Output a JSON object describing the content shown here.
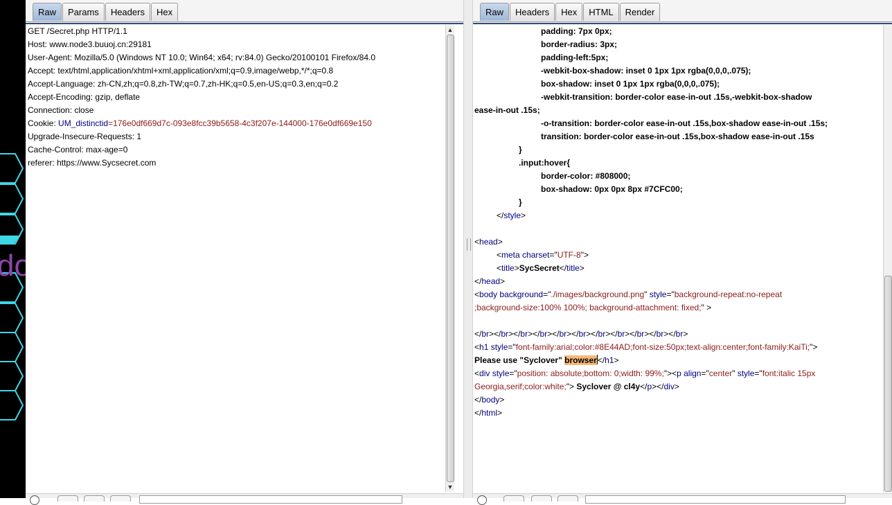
{
  "left_pane": {
    "tabs": [
      "Raw",
      "Params",
      "Headers",
      "Hex"
    ],
    "active_tab": "Raw",
    "request_lines": [
      {
        "text": "GET /Secret.php HTTP/1.1"
      },
      {
        "text": "Host: www.node3.buuoj.cn:29181"
      },
      {
        "text": "User-Agent: Mozilla/5.0 (Windows NT 10.0; Win64; x64; rv:84.0) Gecko/20100101 Firefox/84.0"
      },
      {
        "text": "Accept: text/html,application/xhtml+xml,application/xml;q=0.9,image/webp,*/*;q=0.8"
      },
      {
        "text": "Accept-Language: zh-CN,zh;q=0.8,zh-TW;q=0.7,zh-HK;q=0.5,en-US;q=0.3,en;q=0.2"
      },
      {
        "text": "Accept-Encoding: gzip, deflate"
      },
      {
        "text": "Connection: close"
      },
      {
        "cookie": {
          "label": "Cookie: ",
          "name": "UM_distinctid",
          "eq": "=",
          "value": "176e0df669d7c-093e8fcc39b5658-4c3f207e-144000-176e0df669e150"
        }
      },
      {
        "text": "Upgrade-Insecure-Requests: 1"
      },
      {
        "text": "Cache-Control: max-age=0"
      },
      {
        "text": "referer: https://www.Sycsecret.com"
      }
    ]
  },
  "right_pane": {
    "tabs": [
      "Raw",
      "Headers",
      "Hex",
      "HTML",
      "Render"
    ],
    "active_tab": "Raw",
    "response_lines": [
      {
        "indent": 96,
        "parts": [
          {
            "t": "padding: 7px 0px;",
            "c": "b"
          }
        ]
      },
      {
        "indent": 96,
        "parts": [
          {
            "t": "border-radius: 3px;",
            "c": "b"
          }
        ]
      },
      {
        "indent": 96,
        "parts": [
          {
            "t": "padding-left:5px;",
            "c": "b"
          }
        ]
      },
      {
        "indent": 96,
        "parts": [
          {
            "t": "-webkit-box-shadow: inset 0 1px 1px rgba(0,0,0,.075);",
            "c": "b"
          }
        ]
      },
      {
        "indent": 96,
        "parts": [
          {
            "t": "box-shadow: inset 0 1px 1px rgba(0,0,0,.075);",
            "c": "b"
          }
        ]
      },
      {
        "indent": 96,
        "parts": [
          {
            "t": "-webkit-transition: border-color ease-in-out .15s,-webkit-box-shadow",
            "c": "b"
          }
        ]
      },
      {
        "indent": 0,
        "parts": [
          {
            "t": "ease-in-out .15s;",
            "c": "b"
          }
        ]
      },
      {
        "indent": 96,
        "parts": [
          {
            "t": "-o-transition: border-color ease-in-out .15s,box-shadow ease-in-out .15s;",
            "c": "b"
          }
        ]
      },
      {
        "indent": 96,
        "parts": [
          {
            "t": "transition: border-color ease-in-out .15s,box-shadow ease-in-out .15s",
            "c": "b"
          }
        ]
      },
      {
        "indent": 64,
        "parts": [
          {
            "t": "}",
            "c": "b"
          }
        ]
      },
      {
        "indent": 64,
        "parts": [
          {
            "t": ".input:hover{",
            "c": "b"
          }
        ]
      },
      {
        "indent": 96,
        "parts": [
          {
            "t": "border-color: #808000;",
            "c": "b"
          }
        ]
      },
      {
        "indent": 96,
        "parts": [
          {
            "t": "box-shadow: 0px 0px 8px #7CFC00;",
            "c": "b"
          }
        ]
      },
      {
        "indent": 64,
        "parts": [
          {
            "t": "}",
            "c": "b"
          }
        ]
      },
      {
        "indent": 32,
        "parts": [
          {
            "t": "</",
            "c": "p"
          },
          {
            "t": "style",
            "c": "tag"
          },
          {
            "t": ">",
            "c": "p"
          }
        ]
      },
      {
        "indent": 0,
        "parts": []
      },
      {
        "indent": 0,
        "parts": [
          {
            "t": "<",
            "c": "p"
          },
          {
            "t": "head",
            "c": "tag"
          },
          {
            "t": ">",
            "c": "p"
          }
        ]
      },
      {
        "indent": 32,
        "parts": [
          {
            "t": "<",
            "c": "p"
          },
          {
            "t": "meta",
            "c": "tag"
          },
          {
            "t": " ",
            "c": "p"
          },
          {
            "t": "charset",
            "c": "attr"
          },
          {
            "t": "=\"",
            "c": "p"
          },
          {
            "t": "UTF-8",
            "c": "val"
          },
          {
            "t": "\">",
            "c": "p"
          }
        ]
      },
      {
        "indent": 32,
        "parts": [
          {
            "t": "<",
            "c": "p"
          },
          {
            "t": "title",
            "c": "tag"
          },
          {
            "t": ">",
            "c": "p"
          },
          {
            "t": "SycSecret",
            "c": "b"
          },
          {
            "t": "</",
            "c": "p"
          },
          {
            "t": "title",
            "c": "tag"
          },
          {
            "t": ">",
            "c": "p"
          }
        ]
      },
      {
        "indent": 0,
        "parts": [
          {
            "t": "</",
            "c": "p"
          },
          {
            "t": "head",
            "c": "tag"
          },
          {
            "t": ">",
            "c": "p"
          }
        ]
      },
      {
        "indent": 0,
        "parts": [
          {
            "t": "<",
            "c": "p"
          },
          {
            "t": "body",
            "c": "tag"
          },
          {
            "t": " ",
            "c": "p"
          },
          {
            "t": "background",
            "c": "attr"
          },
          {
            "t": "=\"",
            "c": "p"
          },
          {
            "t": "./images/background.png",
            "c": "val"
          },
          {
            "t": "\" ",
            "c": "p"
          },
          {
            "t": "style",
            "c": "attr"
          },
          {
            "t": "=\"",
            "c": "p"
          },
          {
            "t": "background-repeat:no-repeat",
            "c": "val"
          }
        ]
      },
      {
        "indent": 0,
        "parts": [
          {
            "t": ";background-size:100% 100%; background-attachment: fixed;",
            "c": "val"
          },
          {
            "t": "\" >",
            "c": "p"
          }
        ]
      },
      {
        "indent": 0,
        "parts": []
      },
      {
        "indent": 0,
        "parts": [
          {
            "t": "</",
            "c": "p"
          },
          {
            "t": "br",
            "c": "tag"
          },
          {
            "t": "></",
            "c": "p"
          },
          {
            "t": "br",
            "c": "tag"
          },
          {
            "t": "></",
            "c": "p"
          },
          {
            "t": "br",
            "c": "tag"
          },
          {
            "t": "></",
            "c": "p"
          },
          {
            "t": "br",
            "c": "tag"
          },
          {
            "t": "></",
            "c": "p"
          },
          {
            "t": "br",
            "c": "tag"
          },
          {
            "t": "></",
            "c": "p"
          },
          {
            "t": "br",
            "c": "tag"
          },
          {
            "t": "></",
            "c": "p"
          },
          {
            "t": "br",
            "c": "tag"
          },
          {
            "t": "></",
            "c": "p"
          },
          {
            "t": "br",
            "c": "tag"
          },
          {
            "t": "></",
            "c": "p"
          },
          {
            "t": "br",
            "c": "tag"
          },
          {
            "t": "></",
            "c": "p"
          },
          {
            "t": "br",
            "c": "tag"
          },
          {
            "t": "></",
            "c": "p"
          },
          {
            "t": "br",
            "c": "tag"
          },
          {
            "t": ">",
            "c": "p"
          }
        ]
      },
      {
        "indent": 0,
        "parts": [
          {
            "t": "<",
            "c": "p"
          },
          {
            "t": "h1",
            "c": "tag"
          },
          {
            "t": " ",
            "c": "p"
          },
          {
            "t": "style",
            "c": "attr"
          },
          {
            "t": "=\"",
            "c": "p"
          },
          {
            "t": "font-family:arial;color:#8E44AD;font-size:50px;text-align:center;font-family:KaiTi;",
            "c": "val"
          },
          {
            "t": "\">",
            "c": "p"
          }
        ]
      },
      {
        "indent": 0,
        "parts": [
          {
            "t": "Please use \"Syclover\" ",
            "c": "b"
          },
          {
            "t": "browser",
            "c": "b hl"
          },
          {
            "t": "",
            "c": "caret"
          },
          {
            "t": "</",
            "c": "p"
          },
          {
            "t": "h1",
            "c": "tag"
          },
          {
            "t": ">",
            "c": "p"
          }
        ]
      },
      {
        "indent": 0,
        "parts": [
          {
            "t": "<",
            "c": "p"
          },
          {
            "t": "div",
            "c": "tag"
          },
          {
            "t": " ",
            "c": "p"
          },
          {
            "t": "style",
            "c": "attr"
          },
          {
            "t": "=\"",
            "c": "p"
          },
          {
            "t": "position: absolute;bottom: 0;width: 99%;",
            "c": "val"
          },
          {
            "t": "\"><",
            "c": "p"
          },
          {
            "t": "p",
            "c": "tag"
          },
          {
            "t": " ",
            "c": "p"
          },
          {
            "t": "align",
            "c": "attr"
          },
          {
            "t": "=\"",
            "c": "p"
          },
          {
            "t": "center",
            "c": "val"
          },
          {
            "t": "\" ",
            "c": "p"
          },
          {
            "t": "style",
            "c": "attr"
          },
          {
            "t": "=\"",
            "c": "p"
          },
          {
            "t": "font:italic 15px",
            "c": "val"
          }
        ]
      },
      {
        "indent": 0,
        "parts": [
          {
            "t": "Georgia,serif;color:white;",
            "c": "val"
          },
          {
            "t": "\"> ",
            "c": "p"
          },
          {
            "t": "Syclover @ cl4y",
            "c": "b"
          },
          {
            "t": "</",
            "c": "p"
          },
          {
            "t": "p",
            "c": "tag"
          },
          {
            "t": "></",
            "c": "p"
          },
          {
            "t": "div",
            "c": "tag"
          },
          {
            "t": ">",
            "c": "p"
          }
        ]
      },
      {
        "indent": 0,
        "parts": [
          {
            "t": "</",
            "c": "p"
          },
          {
            "t": "body",
            "c": "tag"
          },
          {
            "t": ">",
            "c": "p"
          }
        ]
      },
      {
        "indent": 0,
        "parts": [
          {
            "t": "</",
            "c": "p"
          },
          {
            "t": "html",
            "c": "tag"
          },
          {
            "t": ">",
            "c": "p"
          }
        ]
      }
    ]
  }
}
